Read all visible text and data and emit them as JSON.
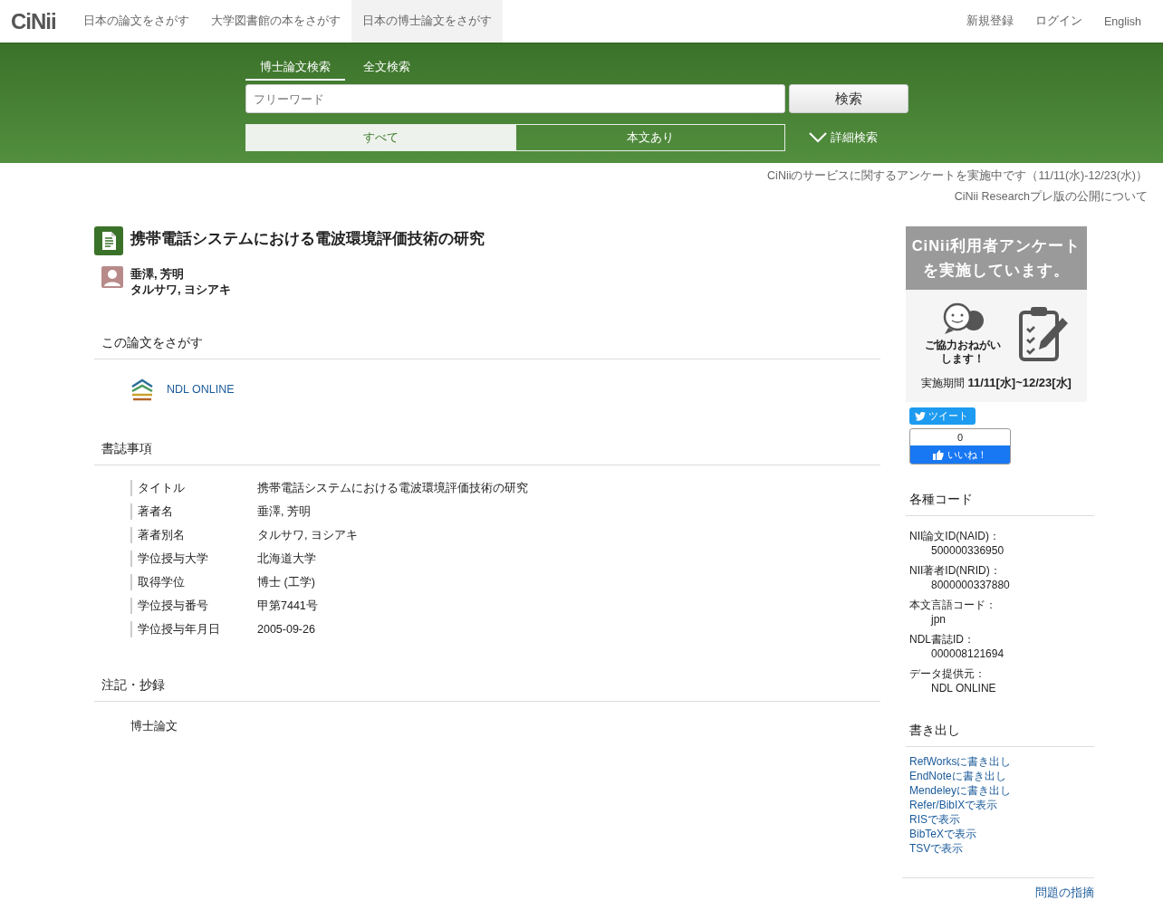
{
  "header": {
    "logo": "CiNii",
    "nav": [
      {
        "label": "日本の論文をさがす",
        "selected": false
      },
      {
        "label": "大学図書館の本をさがす",
        "selected": false
      },
      {
        "label": "日本の博士論文をさがす",
        "selected": true
      }
    ],
    "user_links": [
      "新規登録",
      "ログイン",
      "English"
    ]
  },
  "search": {
    "tabs": [
      {
        "label": "博士論文検索",
        "selected": true
      },
      {
        "label": "全文検索",
        "selected": false
      }
    ],
    "placeholder": "フリーワード",
    "button": "検索",
    "filters": [
      {
        "label": "すべて",
        "selected": true
      },
      {
        "label": "本文あり",
        "selected": false
      }
    ],
    "advanced": "詳細検索"
  },
  "notices": [
    "CiNiiのサービスに関するアンケートを実施中です（11/11(水)-12/23(水)）",
    "CiNii Researchプレ版の公開について"
  ],
  "article": {
    "title": "携帯電話システムにおける電波環境評価技術の研究",
    "author": {
      "name": "垂澤, 芳明",
      "kana": "タルサワ, ヨシアキ"
    },
    "find": {
      "heading": "この論文をさがす",
      "link": "NDL ONLINE"
    },
    "biblio": {
      "heading": "書誌事項",
      "rows": [
        {
          "label": "タイトル",
          "value": "携帯電話システムにおける電波環境評価技術の研究"
        },
        {
          "label": "著者名",
          "value": "垂澤, 芳明"
        },
        {
          "label": "著者別名",
          "value": "タルサワ, ヨシアキ"
        },
        {
          "label": "学位授与大学",
          "value": "北海道大学"
        },
        {
          "label": "取得学位",
          "value": "博士 (工学)"
        },
        {
          "label": "学位授与番号",
          "value": "甲第7441号"
        },
        {
          "label": "学位授与年月日",
          "value": "2005-09-26"
        }
      ]
    },
    "notes": {
      "heading": "注記・抄録",
      "text": "博士論文"
    }
  },
  "sidebar": {
    "banner": {
      "heading": "CiNii利用者アンケートを実施しています。",
      "caption": "ご協力おねがいします！",
      "period_label": "実施期間",
      "period": "11/11[水]~12/23[水]"
    },
    "tweet": "ツイート",
    "like": {
      "count": "0",
      "label": "いいね！"
    },
    "codes": {
      "heading": "各種コード",
      "items": [
        {
          "label": "NII論文ID(NAID)：",
          "value": "500000336950"
        },
        {
          "label": "NII著者ID(NRID)：",
          "value": "8000000337880"
        },
        {
          "label": "本文言語コード：",
          "value": "jpn"
        },
        {
          "label": "NDL書誌ID：",
          "value": "000008121694"
        },
        {
          "label": "データ提供元：",
          "value": "NDL ONLINE"
        }
      ]
    },
    "export": {
      "heading": "書き出し",
      "links": [
        "RefWorksに書き出し",
        "EndNoteに書き出し",
        "Mendeleyに書き出し",
        "Refer/BibIXで表示",
        "RISで表示",
        "BibTeXで表示",
        "TSVで表示"
      ]
    },
    "report": "問題の指摘"
  }
}
